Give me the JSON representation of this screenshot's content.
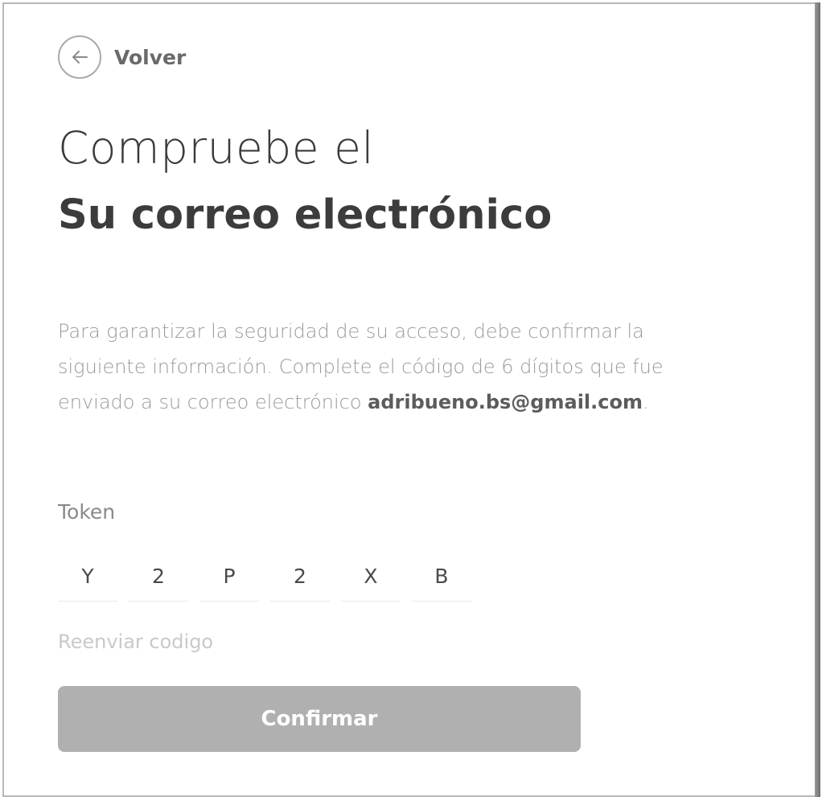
{
  "back": {
    "label": "Volver",
    "icon": "arrow-left-icon"
  },
  "heading": {
    "line1": "Compruebe el",
    "line2": "Su correo electrónico"
  },
  "description": {
    "text": "Para garantizar la seguridad de su acceso, debe confirmar la siguiente información. Complete el código de 6 dígitos que fue enviado a su correo electrónico ",
    "email": "adribueno.bs@gmail.com",
    "suffix": "."
  },
  "token": {
    "label": "Token",
    "digits": [
      "Y",
      "2",
      "P",
      "2",
      "X",
      "B"
    ]
  },
  "resend_label": "Reenviar codigo",
  "confirm_label": "Confirmar",
  "colors": {
    "button_bg": "#b0b0b0",
    "heading": "#3c3c3c",
    "muted_text": "#9a9a9a"
  }
}
